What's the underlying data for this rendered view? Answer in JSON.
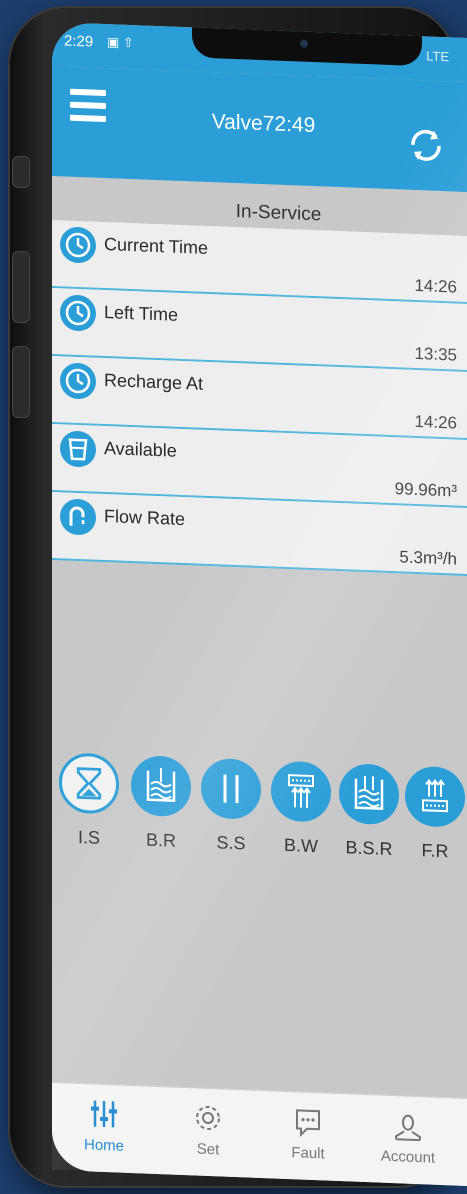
{
  "status_bar": {
    "time": "2:29",
    "network": "LTE"
  },
  "header": {
    "title": "Valve72:49"
  },
  "section_title": "In-Service",
  "rows": [
    {
      "label": "Current Time",
      "value": "14:26",
      "icon": "clock-icon"
    },
    {
      "label": "Left Time",
      "value": "13:35",
      "icon": "clock-icon"
    },
    {
      "label": "Recharge At",
      "value": "14:26",
      "icon": "clock-icon"
    },
    {
      "label": "Available",
      "value": "99.96m³",
      "icon": "water-cup-icon"
    },
    {
      "label": "Flow Rate",
      "value": "5.3m³/h",
      "icon": "faucet-icon"
    }
  ],
  "modes": [
    {
      "label": "I.S",
      "icon": "hourglass-icon",
      "active": true
    },
    {
      "label": "B.R",
      "icon": "brine-tank-icon"
    },
    {
      "label": "S.S",
      "icon": "slow-rinse-icon"
    },
    {
      "label": "B.W",
      "icon": "backwash-icon"
    },
    {
      "label": "B.S.R",
      "icon": "brine-slow-rinse-icon"
    },
    {
      "label": "F.R",
      "icon": "fast-rinse-icon"
    }
  ],
  "tabs": [
    {
      "label": "Home",
      "icon": "sliders-icon",
      "active": true
    },
    {
      "label": "Set",
      "icon": "gear-icon"
    },
    {
      "label": "Fault",
      "icon": "chat-icon"
    },
    {
      "label": "Account",
      "icon": "person-icon"
    }
  ],
  "colors": {
    "primary": "#2b9ed8",
    "background": "#c8c8c8",
    "row": "#eeeeee"
  }
}
